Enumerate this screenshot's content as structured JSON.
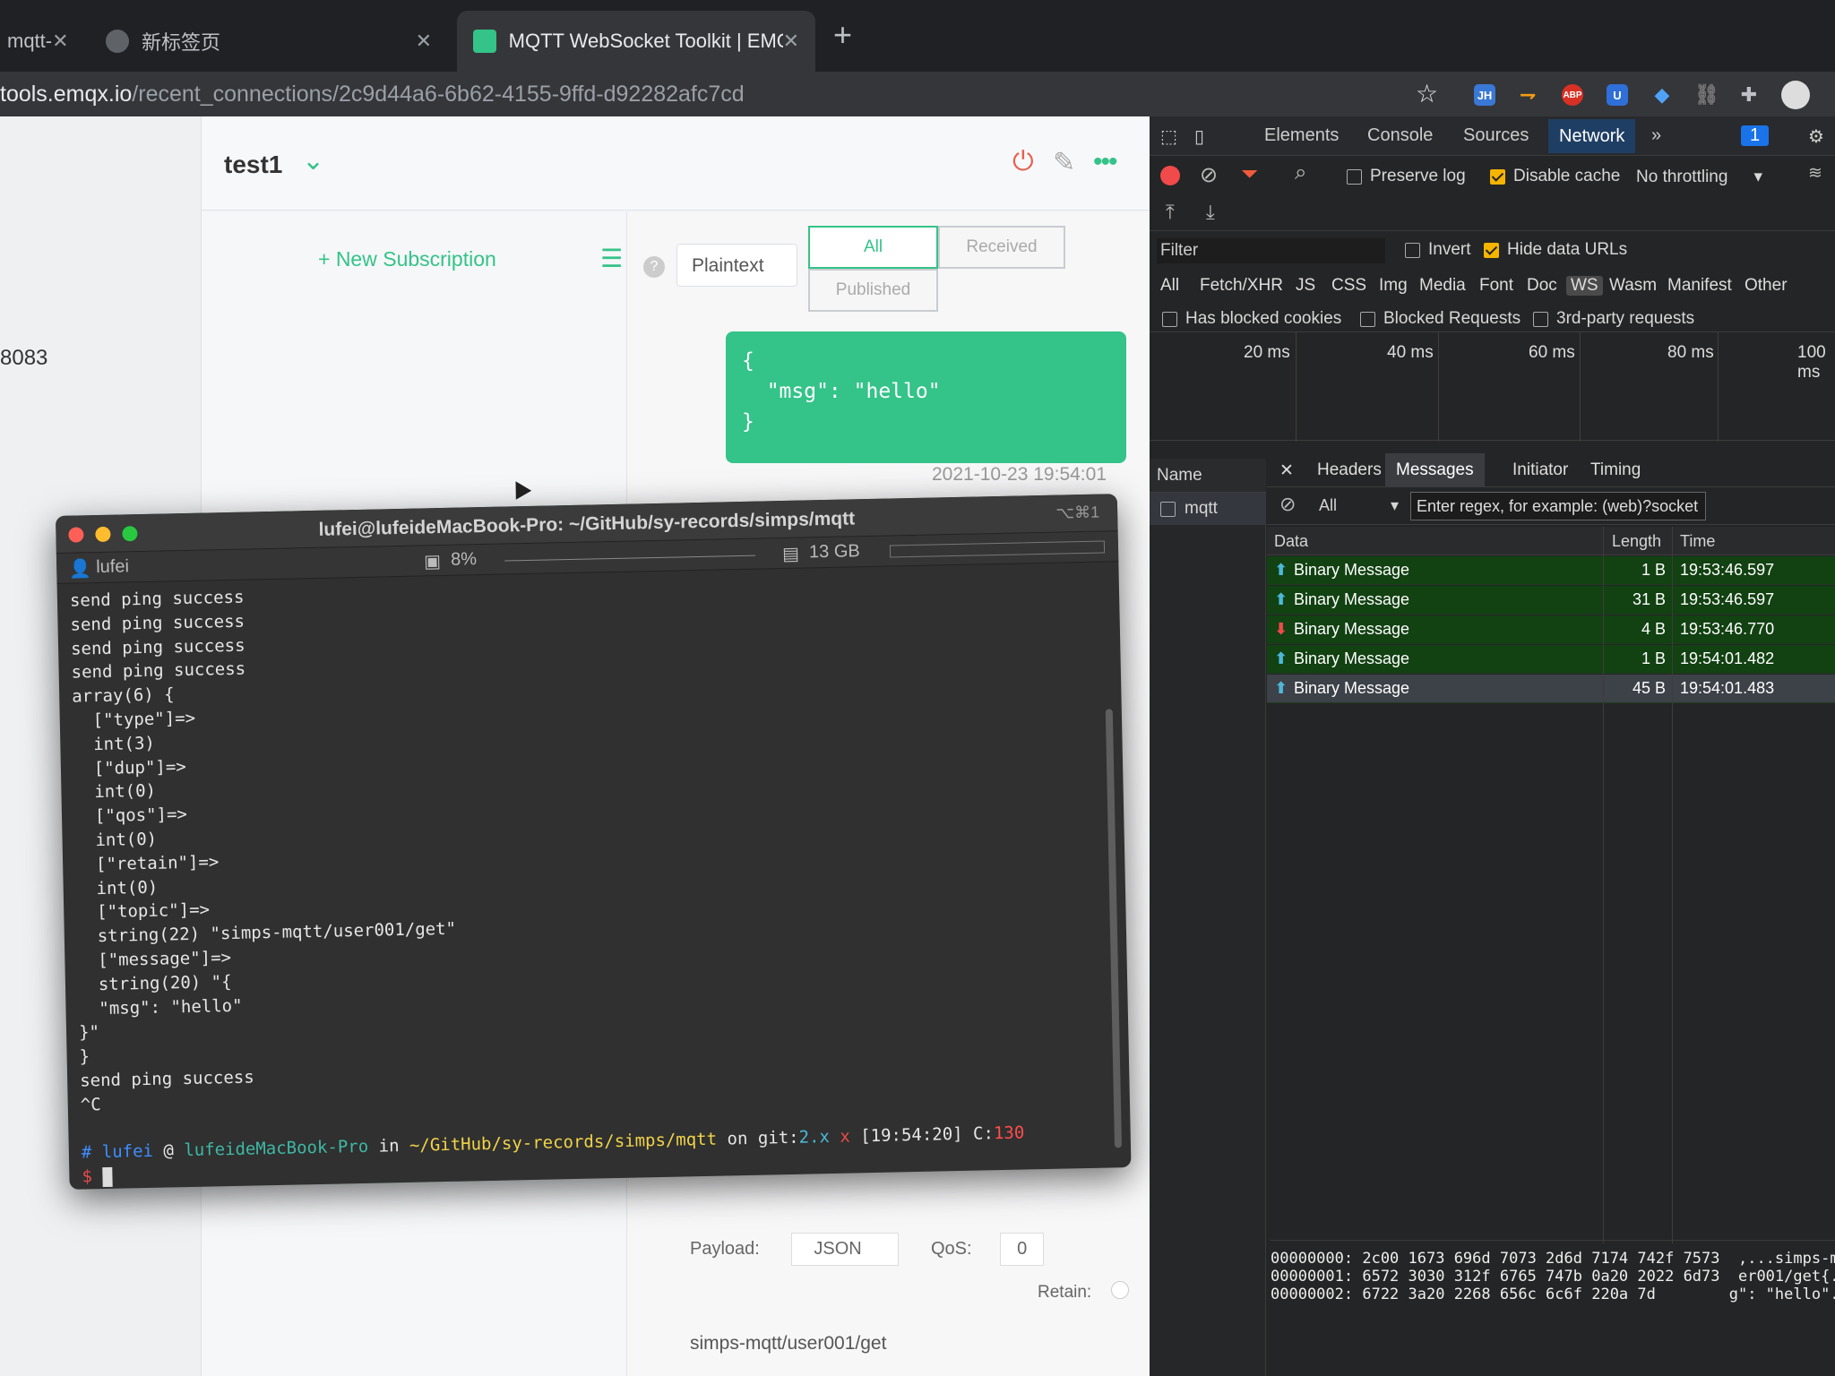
{
  "browser": {
    "tabs": [
      {
        "title": "mqtt-",
        "active": false
      },
      {
        "title": "新标签页",
        "active": false
      },
      {
        "title": "MQTT WebSocket Toolkit | EMQ",
        "active": true
      }
    ],
    "new_tab": "+",
    "url_host": "tools.emqx.io",
    "url_path": "/recent_connections/2c9d44a6-6b62-4155-9ffd-d92282afc7cd",
    "extensions": [
      "JH",
      "ABP"
    ]
  },
  "mqttx": {
    "port_fragment": "8083",
    "connection_name": "test1",
    "new_subscription": "+ New Subscription",
    "payload_format": "Plaintext",
    "filter_all": "All",
    "filter_received": "Received",
    "filter_published": "Published",
    "message_payload": "{\n  \"msg\": \"hello\"\n}",
    "message_time": "2021-10-23 19:54:01",
    "payload_label": "Payload:",
    "payload_type": "JSON",
    "qos_label": "QoS:",
    "qos_value": "0",
    "retain_label": "Retain:",
    "topic": "simps-mqtt/user001/get"
  },
  "terminal": {
    "title": "lufei@lufeideMacBook-Pro: ~/GitHub/sy-records/simps/mqtt",
    "shortcut": "⌥⌘1",
    "status_user": "lufei",
    "status_cpu": "8%",
    "status_mem": "13 GB",
    "output": "send ping success\nsend ping success\nsend ping success\nsend ping success\narray(6) {\n  [\"type\"]=>\n  int(3)\n  [\"dup\"]=>\n  int(0)\n  [\"qos\"]=>\n  int(0)\n  [\"retain\"]=>\n  int(0)\n  [\"topic\"]=>\n  string(22) \"simps-mqtt/user001/get\"\n  [\"message\"]=>\n  string(20) \"{\n  \"msg\": \"hello\"\n}\"\n}\nsend ping success\n^C",
    "prompt_user": "lufei",
    "prompt_at": "@",
    "prompt_host": "lufeideMacBook-Pro",
    "prompt_in": "in",
    "prompt_path": "~/GitHub/sy-records/simps/mqtt",
    "prompt_on": "on git:",
    "prompt_branch": "2.x",
    "prompt_x": "x",
    "prompt_time": "[19:54:20]",
    "prompt_code_label": "C:",
    "prompt_code": "130",
    "prompt_symbol": "$"
  },
  "devtools": {
    "tabs": [
      "Elements",
      "Console",
      "Sources",
      "Network"
    ],
    "active_tab": "Network",
    "more": "»",
    "badge": "1",
    "preserve_log": "Preserve log",
    "disable_cache": "Disable cache",
    "throttling": "No throttling",
    "filter_placeholder": "Filter",
    "invert": "Invert",
    "hide_data_urls": "Hide data URLs",
    "types": [
      "All",
      "Fetch/XHR",
      "JS",
      "CSS",
      "Img",
      "Media",
      "Font",
      "Doc",
      "WS",
      "Wasm",
      "Manifest",
      "Other"
    ],
    "selected_type": "WS",
    "has_blocked_cookies": "Has blocked cookies",
    "blocked_requests": "Blocked Requests",
    "third_party": "3rd-party requests",
    "timeline_labels": [
      "20 ms",
      "40 ms",
      "60 ms",
      "80 ms",
      "100 ms"
    ],
    "name_header": "Name",
    "request_name": "mqtt",
    "detail_tabs": [
      "Headers",
      "Messages",
      "Initiator",
      "Timing"
    ],
    "active_detail_tab": "Messages",
    "message_filter": "All",
    "regex_placeholder": "Enter regex, for example: (web)?socket",
    "col_data": "Data",
    "col_length": "Length",
    "col_time": "Time",
    "messages": [
      {
        "direction": "up",
        "data": "Binary Message",
        "length": "1 B",
        "time": "19:53:46.597",
        "selected": false
      },
      {
        "direction": "up",
        "data": "Binary Message",
        "length": "31 B",
        "time": "19:53:46.597",
        "selected": false
      },
      {
        "direction": "down",
        "data": "Binary Message",
        "length": "4 B",
        "time": "19:53:46.770",
        "selected": false
      },
      {
        "direction": "up",
        "data": "Binary Message",
        "length": "1 B",
        "time": "19:54:01.482",
        "selected": false
      },
      {
        "direction": "up",
        "data": "Binary Message",
        "length": "45 B",
        "time": "19:54:01.483",
        "selected": true
      }
    ],
    "hexdump": "00000000: 2c00 1673 696d 7073 2d6d 7174 742f 7573  ,...simps-mqtt/us\n00000001: 6572 3030 312f 6765 747b 0a20 2022 6d73  er001/get{.  \"ms\n00000002: 6722 3a20 2268 656c 6c6f 220a 7d        g\": \"hello\".}",
    "colors": {
      "sent_row": "#124112",
      "selected_row": "#3d4148",
      "record": "#f04a4a",
      "filter": "#f05a3c"
    }
  }
}
